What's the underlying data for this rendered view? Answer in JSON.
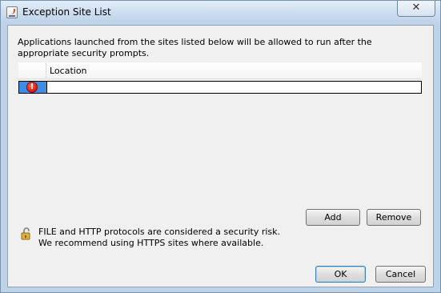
{
  "window": {
    "title": "Exception Site List",
    "close_glyph": "✕"
  },
  "info_text": "Applications launched from the sites listed below will be allowed to run after the appropriate security prompts.",
  "table": {
    "columns": [
      "",
      "Location"
    ],
    "rows": [
      {
        "status_icon": "error-icon",
        "status_glyph": "!",
        "location": ""
      }
    ]
  },
  "buttons": {
    "add": "Add",
    "remove": "Remove",
    "ok": "OK",
    "cancel": "Cancel"
  },
  "warning": {
    "icon": "unlocked-padlock-icon",
    "line1": "FILE and HTTP protocols are considered a security risk.",
    "line2": "We recommend using HTTPS sites where available."
  },
  "colors": {
    "selected_cell": "#3d8de3",
    "error_red": "#d31a0e",
    "titlebar": "#c9dbee"
  }
}
